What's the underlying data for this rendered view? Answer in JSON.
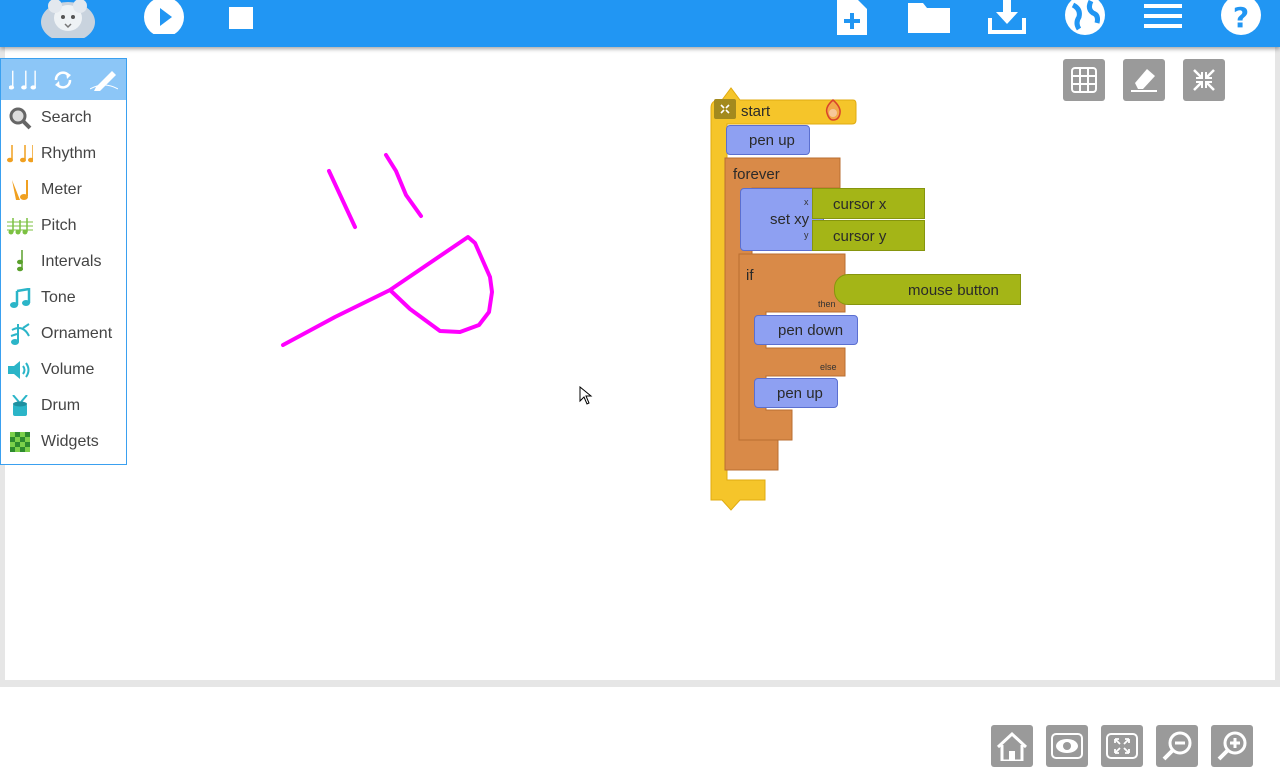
{
  "toolbar": {
    "logo_icon": "mouse-logo-icon",
    "play_icon": "play-icon",
    "stop_icon": "stop-icon",
    "new_icon": "new-file-icon",
    "open_icon": "folder-icon",
    "save_icon": "download-icon",
    "planet_icon": "globe-icon",
    "menu_icon": "menu-icon",
    "help_icon": "help-icon",
    "color": "#2196f3"
  },
  "palette": {
    "tabs": [
      "music-tab",
      "flow-tab",
      "graphics-tab"
    ],
    "items": [
      {
        "label": "Search",
        "icon": "search-icon",
        "color": "#666666"
      },
      {
        "label": "Rhythm",
        "icon": "rhythm-icon",
        "color": "#f0a020"
      },
      {
        "label": "Meter",
        "icon": "meter-icon",
        "color": "#f0a020"
      },
      {
        "label": "Pitch",
        "icon": "pitch-icon",
        "color": "#7cc142"
      },
      {
        "label": "Intervals",
        "icon": "intervals-icon",
        "color": "#5aa02c"
      },
      {
        "label": "Tone",
        "icon": "tone-icon",
        "color": "#2bb5c8"
      },
      {
        "label": "Ornament",
        "icon": "ornament-icon",
        "color": "#2bb5c8"
      },
      {
        "label": "Volume",
        "icon": "volume-icon",
        "color": "#2bb5c8"
      },
      {
        "label": "Drum",
        "icon": "drum-icon",
        "color": "#2bb5c8"
      },
      {
        "label": "Widgets",
        "icon": "widgets-icon",
        "color": "#39a33a"
      }
    ]
  },
  "canvas_tools": {
    "grid_icon": "grid-icon",
    "clear_icon": "eraser-icon",
    "collapse_icon": "collapse-icon"
  },
  "blocks": {
    "start": "start",
    "pen_up_1": "pen up",
    "forever": "forever",
    "set_xy": "set xy",
    "x_label": "x",
    "y_label": "y",
    "cursor_x": "cursor x",
    "cursor_y": "cursor y",
    "if": "if",
    "then": "then",
    "else": "else",
    "mouse_button": "mouse button",
    "pen_down": "pen down",
    "pen_up_2": "pen up",
    "colors": {
      "start": "#f5c52a",
      "pen": "#8ea0f2",
      "flow": "#d98a48",
      "sensor": "#a4b517"
    }
  },
  "drawing": {
    "pen_color": "#ff00ff"
  },
  "bottom": {
    "home_icon": "home-icon",
    "show_icon": "eye-icon",
    "expand_icon": "expand-icon",
    "zoom_out_icon": "zoom-out-icon",
    "zoom_in_icon": "zoom-in-icon"
  }
}
